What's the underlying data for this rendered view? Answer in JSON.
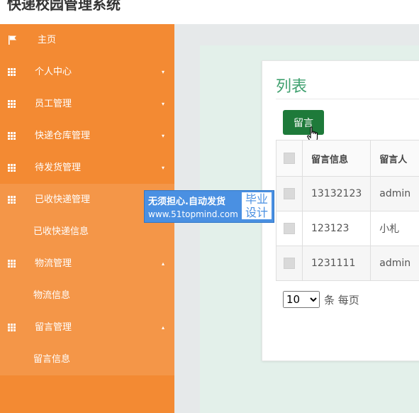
{
  "header": {
    "app_title": "快递校园管理系统"
  },
  "sidebar": {
    "items": [
      {
        "label": "主页",
        "icon": "flag-icon",
        "caret": ""
      },
      {
        "label": "个人中心",
        "icon": "grid-icon",
        "caret": "▾"
      },
      {
        "label": "员工管理",
        "icon": "grid-icon",
        "caret": "▾"
      },
      {
        "label": "快递仓库管理",
        "icon": "grid-icon",
        "caret": "▾"
      },
      {
        "label": "待发货管理",
        "icon": "grid-icon",
        "caret": "▾"
      },
      {
        "label": "已收快递管理",
        "icon": "grid-icon",
        "caret": ""
      },
      {
        "label": "已收快递信息"
      },
      {
        "label": "物流管理",
        "icon": "grid-icon",
        "caret": "▴"
      },
      {
        "label": "物流信息"
      },
      {
        "label": "留言管理",
        "icon": "grid-icon",
        "caret": "▴"
      },
      {
        "label": "留言信息"
      }
    ]
  },
  "main": {
    "title": "列表",
    "add_button": "留言",
    "table": {
      "headers": [
        "留言信息",
        "留言人"
      ],
      "rows": [
        [
          "13132123",
          "admin"
        ],
        [
          "123123",
          "小札"
        ],
        [
          "1231111",
          "admin"
        ]
      ]
    },
    "pager": {
      "page_size": "10",
      "suffix": "条 每页"
    }
  },
  "watermark": {
    "line1": "无须担心.自动发货",
    "url": "www.51topmind.com",
    "badge1": "毕业",
    "badge2": "设计"
  },
  "colors": {
    "sidebar": "#f38a33",
    "sidebar_active": "#f49648",
    "accent_green": "#41a170",
    "button_green": "#1e7a3a"
  }
}
